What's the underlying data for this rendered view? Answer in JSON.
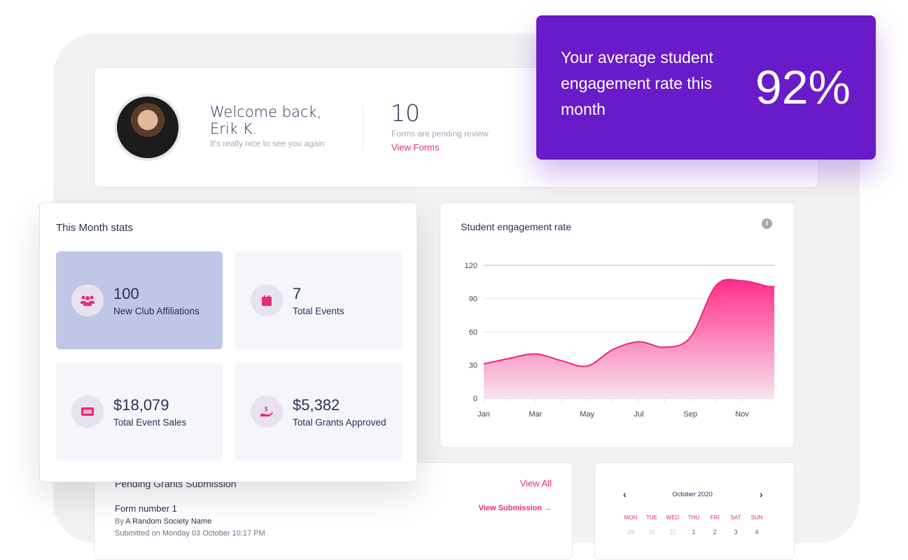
{
  "welcome": {
    "greeting": "Welcome back,",
    "name": "Erik K.",
    "subtitle": "It's really nice to see you again",
    "pending_count": "10",
    "pending_label": "Forms are pending review",
    "view_forms": "View Forms"
  },
  "promo": {
    "text": "Your average student engagement rate this month",
    "value": "92%",
    "bg": "#691ac9"
  },
  "stats": {
    "title": "This Month stats",
    "tiles": [
      {
        "value": "100",
        "label": "New Club Affiliations",
        "icon": "users-icon",
        "active": true
      },
      {
        "value": "7",
        "label": "Total Events",
        "icon": "calendar-icon"
      },
      {
        "value": "$18,079",
        "label": "Total Event Sales",
        "icon": "ticket-icon"
      },
      {
        "value": "$5,382",
        "label": "Total Grants Approved",
        "icon": "hand-dollar-icon"
      }
    ]
  },
  "chart_data": {
    "type": "area",
    "title": "Student engagement rate",
    "x": [
      "Jan",
      "Feb",
      "Mar",
      "Apr",
      "May",
      "Jun",
      "Jul",
      "Aug",
      "Sep",
      "Oct",
      "Nov",
      "Dec"
    ],
    "x_tick_labels": [
      "Jan",
      "Mar",
      "May",
      "Jul",
      "Sep",
      "Nov"
    ],
    "values": [
      31,
      36,
      40,
      34,
      29,
      44,
      51,
      46,
      55,
      102,
      106,
      101
    ],
    "ylim": [
      0,
      120
    ],
    "yticks": [
      "0",
      "30",
      "60",
      "90",
      "120"
    ],
    "grid": true,
    "color": "#ea2a78"
  },
  "grants": {
    "title": "Pending Grants Submission",
    "view_all": "View All",
    "item": {
      "title": "Form number 1",
      "by_prefix": "By",
      "by": "A Random Society Name",
      "submitted": "Submitted on Monday 03 October 10:17 PM",
      "action": "View Submission →"
    }
  },
  "calendar": {
    "month": "October 2020",
    "days": [
      "MON",
      "TUE",
      "WED",
      "THU",
      "FRI",
      "SAT",
      "SUN"
    ],
    "dates": [
      "29",
      "30",
      "31",
      "1",
      "2",
      "3",
      "4"
    ]
  },
  "accent": "#ea2a78"
}
